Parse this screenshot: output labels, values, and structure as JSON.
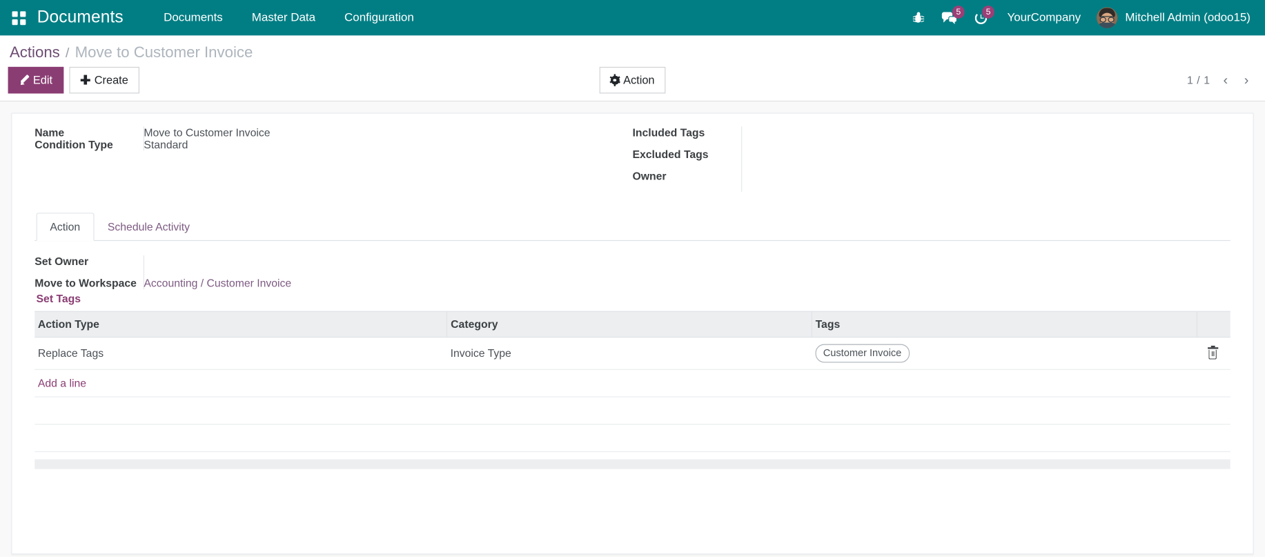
{
  "navbar": {
    "apps_icon": "apps-grid-icon",
    "brand": "Documents",
    "menus": [
      {
        "label": "Documents"
      },
      {
        "label": "Master Data"
      },
      {
        "label": "Configuration"
      }
    ],
    "icons": [
      {
        "name": "bug-icon",
        "badge": ""
      },
      {
        "name": "messages-icon",
        "badge": "5"
      },
      {
        "name": "activities-icon",
        "badge": "5"
      }
    ],
    "company": "YourCompany",
    "user": "Mitchell Admin (odoo15)",
    "accent_color": "#017e84",
    "badge_color": "#9c3f77"
  },
  "control_panel": {
    "breadcrumb": {
      "root": "Actions",
      "separator": "/",
      "current": "Move to Customer Invoice"
    },
    "edit_label": "Edit",
    "create_label": "Create",
    "action_label": "Action",
    "pager": {
      "value": "1 / 1",
      "previous_icon": "chevron-left-icon",
      "next_icon": "chevron-right-icon"
    }
  },
  "form": {
    "left_fields": [
      {
        "label": "Name",
        "value": "Move to Customer Invoice"
      },
      {
        "label": "Condition Type",
        "value": "Standard"
      }
    ],
    "right_fields": [
      {
        "label": "Included Tags",
        "value": ""
      },
      {
        "label": "Excluded Tags",
        "value": ""
      },
      {
        "label": "Owner",
        "value": ""
      }
    ],
    "tabs": [
      {
        "label": "Action",
        "active": true
      },
      {
        "label": "Schedule Activity",
        "active": false
      }
    ],
    "action_tab": {
      "fields": [
        {
          "label": "Set Owner",
          "value": "",
          "is_link": false
        },
        {
          "label": "Move to Workspace",
          "value": "Accounting / Customer Invoice",
          "is_link": true
        }
      ],
      "set_tags_title": "Set Tags",
      "tags_table": {
        "columns": [
          "Action Type",
          "Category",
          "Tags",
          ""
        ],
        "rows": [
          {
            "action_type": "Replace Tags",
            "category": "Invoice Type",
            "tags": [
              "Customer Invoice"
            ],
            "delete_icon": "trash-icon"
          }
        ],
        "add_line_label": "Add a line"
      }
    }
  }
}
